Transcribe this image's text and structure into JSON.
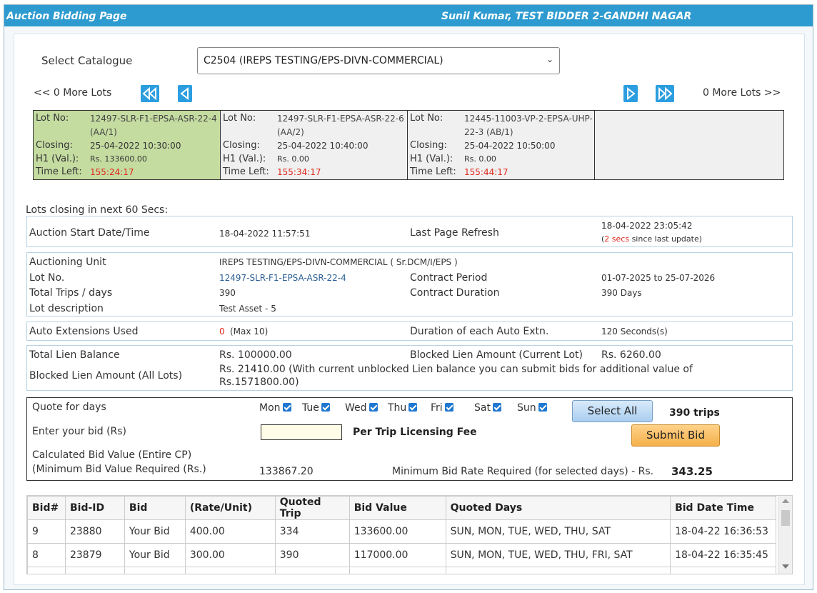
{
  "header": {
    "title": "Auction Bidding Page",
    "user": "Sunil Kumar, TEST BIDDER 2-GANDHI NAGAR"
  },
  "catalogue": {
    "label": "Select Catalogue",
    "selected": "C2504  (IREPS TESTING/EPS-DIVN-COMMERCIAL)"
  },
  "nav": {
    "prev_more": "<< 0 More Lots",
    "next_more": "0 More Lots >>"
  },
  "lot_labels": {
    "lot_no": "Lot No:",
    "closing": "Closing:",
    "h1": "H1 (Val.):",
    "time_left": "Time Left:"
  },
  "lots": [
    {
      "lot_no": "12497-SLR-F1-EPSA-ASR-22-4 (AA/1)",
      "closing": "25-04-2022 10:30:00",
      "h1": "Rs. 133600.00",
      "time_left": "155:24:17"
    },
    {
      "lot_no": "12497-SLR-F1-EPSA-ASR-22-6 (AA/2)",
      "closing": "25-04-2022 10:40:00",
      "h1": "Rs. 0.00",
      "time_left": "155:34:17"
    },
    {
      "lot_no": "12445-11003-VP-2-EPSA-UHP-22-3 (AB/1)",
      "closing": "25-04-2022 10:50:00",
      "h1": "Rs. 0.00",
      "time_left": "155:44:17"
    }
  ],
  "closing_soon": "Lots closing in next 60 Secs:",
  "auction": {
    "start_label": "Auction Start Date/Time",
    "start_value": "18-04-2022 11:57:51",
    "refresh_label": "Last Page Refresh",
    "refresh_value": "18-04-2022 23:05:42",
    "refresh_secs": "2  secs",
    "refresh_suffix": " since last update)",
    "refresh_prefix": "("
  },
  "details": {
    "unit_label": "Auctioning Unit",
    "unit_value": "IREPS TESTING/EPS-DIVN-COMMERCIAL ( Sr.DCM/I/EPS )",
    "lotno_label": "Lot No.",
    "lotno_value": "12497-SLR-F1-EPSA-ASR-22-4",
    "trips_label": "Total Trips / days",
    "trips_value": "390",
    "desc_label": "Lot description",
    "desc_value": "Test Asset - 5",
    "period_label": "Contract Period",
    "period_value": "01-07-2025 to 25-07-2026",
    "duration_label": "Contract Duration",
    "duration_value": "390 Days"
  },
  "extensions": {
    "used_label": "Auto Extensions Used",
    "used_value": "0",
    "used_max": "(Max 10)",
    "dur_label": "Duration of each Auto Extn.",
    "dur_value": "120 Seconds(s)"
  },
  "lien": {
    "total_label": "Total Lien Balance",
    "total_value": "Rs. 100000.00",
    "blocked_cur_label": "Blocked Lien Amount (Current Lot)",
    "blocked_cur_value": "Rs. 6260.00",
    "blocked_all_label": "Blocked Lien Amount (All Lots)",
    "blocked_all_value_1": "Rs. 21410.00 (With current unblocked Lien balance you can submit bids for additional value of",
    "blocked_all_value_2": "Rs.1571800.00)"
  },
  "quote": {
    "days_label": "Quote for days",
    "days": [
      "Mon",
      "Tue",
      "Wed",
      "Thu",
      "Fri",
      "Sat",
      "Sun"
    ],
    "select_all": "Select All",
    "trips": "390  trips",
    "bid_label": "Enter your bid (Rs)",
    "bid_value": "",
    "per_trip": "Per Trip Licensing Fee",
    "submit": "Submit Bid",
    "calc_label": "Calculated Bid Value (Entire CP)",
    "min_label": "(Minimum Bid Value Required (Rs.)",
    "min_value": "133867.20",
    "min_rate_label": "Minimum Bid Rate Required (for selected days) - Rs.",
    "min_rate_value": "343.25"
  },
  "bids": {
    "columns": [
      "Bid#",
      "Bid-ID",
      "Bid",
      "(Rate/Unit)",
      "Quoted Trip",
      "Bid Value",
      "Quoted Days",
      "Bid Date Time"
    ],
    "rows": [
      [
        "9",
        "23880",
        "Your Bid",
        "400.00",
        "334",
        "133600.00",
        "SUN, MON, TUE, WED, THU, SAT",
        "18-04-22 16:36:53"
      ],
      [
        "8",
        "23879",
        "Your Bid",
        "300.00",
        "390",
        "117000.00",
        "SUN, MON, TUE, WED, THU, FRI, SAT",
        "18-04-22 16:35:45"
      ]
    ]
  }
}
